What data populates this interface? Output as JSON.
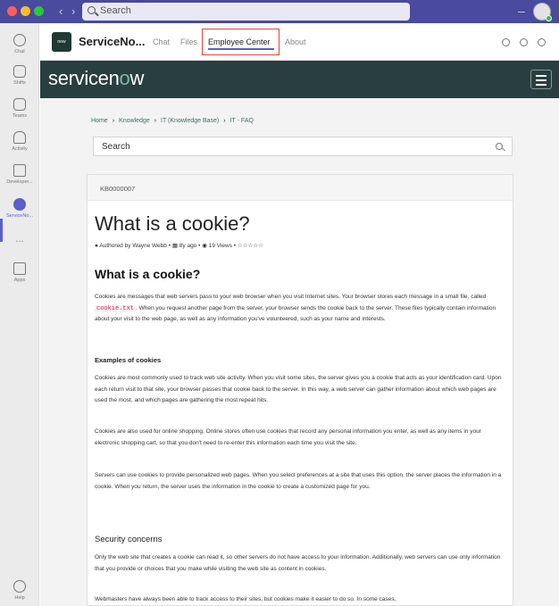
{
  "titlebar": {
    "search_placeholder": "Search"
  },
  "rail": {
    "items": [
      {
        "label": "Chat",
        "icon": "chat-icon"
      },
      {
        "label": "Shifts",
        "icon": "shifts-icon"
      },
      {
        "label": "Teams",
        "icon": "teams-icon"
      },
      {
        "label": "Activity",
        "icon": "bell-icon"
      },
      {
        "label": "Developer...",
        "icon": "developer-icon"
      },
      {
        "label": "ServiceNo...",
        "icon": "servicenow-icon",
        "active": true
      },
      {
        "label": "...",
        "icon": "more-icon"
      },
      {
        "label": "Apps",
        "icon": "apps-icon"
      },
      {
        "label": "Help",
        "icon": "help-icon"
      }
    ]
  },
  "app_header": {
    "logo_text": "now",
    "app_name": "ServiceNo...",
    "tabs": [
      "Chat",
      "Files",
      "Employee Center",
      "About"
    ],
    "selected_tab": "Employee Center"
  },
  "banner": {
    "logo_pre": "servicen",
    "logo_o": "o",
    "logo_post": "w"
  },
  "breadcrumb": [
    "Home",
    "Knowledge",
    "IT (Knowledge Base)",
    "IT - FAQ"
  ],
  "kb_search": {
    "placeholder": "Search"
  },
  "article": {
    "number": "KB0000007",
    "title": "What is a cookie?",
    "meta": {
      "author": "Authored by Wayne Webb",
      "age": "8y ago",
      "views": "19 Views",
      "rating_stars": "☆☆☆☆☆"
    },
    "heading": "What is a cookie?",
    "intro_part1": "Cookies are messages that web servers pass to your web browser when you visit Internet sites. Your browser stores each message in a small file, called ",
    "intro_code": "cookie.txt",
    "intro_part2": ". When you request another page from the server, your browser sends the cookie back to the server. These files typically contain information about your visit to the web page, as well as any information you've volunteered, such as your name and interests.",
    "examples_heading": "Examples of cookies",
    "examples_p1": "Cookies are most commonly used to track web site activity. When you visit some sites, the server gives you a cookie that acts as your identification card. Upon each return visit to that site, your browser passes that cookie back to the server. In this way, a web server can gather information about which web pages are used the most, and which pages are gathering the most repeat hits.",
    "examples_p2": "Cookies are also used for online shopping. Online stores often use cookies that record any personal information you enter, as well as any items in your electronic shopping cart, so that you don't need to re-enter this information each time you visit the site.",
    "examples_p3": "Servers can use cookies to provide personalized web pages. When you select preferences at a site that uses this option, the server places the information in a cookie. When you return, the server uses the information in the cookie to create a customized page for you.",
    "security_heading": "Security concerns",
    "security_p1": "Only the web site that creates a cookie can read it, so other servers do not have access to your information. Additionally, web servers can use only information that you provide or choices that you make while visiting the web site as content in cookies.",
    "security_p2": "Webmasters have always been able to track access to their sites, but cookies make it easier to do so. In some cases,"
  },
  "colors": {
    "teams_purple": "#4a4a9e",
    "servicenow_dark": "#293e40",
    "servicenow_green": "#81b5a1",
    "tab_highlight": "#d8493a"
  }
}
